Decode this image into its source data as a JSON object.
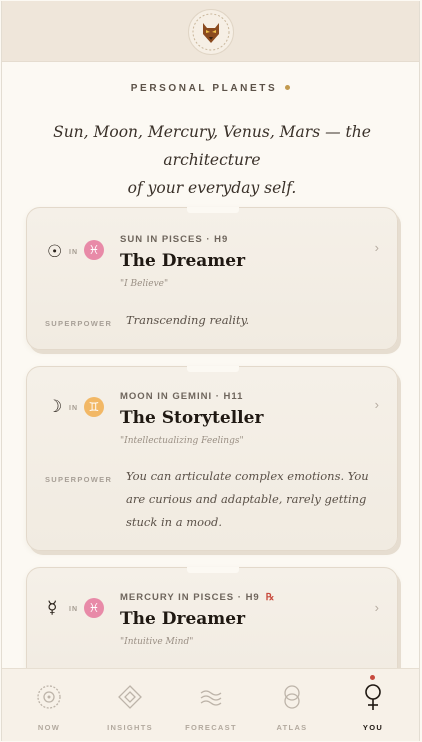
{
  "header": {
    "logo_icon": "wolf-medallion-icon"
  },
  "section": {
    "title": "PERSONAL PLANETS",
    "dot_color": "#c29a4f"
  },
  "intro": {
    "line1": "Sun, Moon, Mercury, Venus, Mars — the architecture",
    "line2": "of your everyday self."
  },
  "cards": [
    {
      "planet_glyph": "☉",
      "planet_icon": "sun-icon",
      "in_label": "IN",
      "sign_glyph": "♓",
      "sign_icon": "pisces-icon",
      "sign_color": "#e88aa8",
      "placement": "SUN IN PISCES · H9",
      "archetype": "The Dreamer",
      "motto": "\"I Believe\"",
      "superpower_label": "SUPERPOWER",
      "superpower": "Transcending reality."
    },
    {
      "planet_glyph": "☽",
      "planet_icon": "moon-icon",
      "in_label": "IN",
      "sign_glyph": "♊",
      "sign_icon": "gemini-icon",
      "sign_color": "#f2b866",
      "placement": "MOON IN GEMINI · H11",
      "archetype": "The Storyteller",
      "motto": "\"Intellectualizing Feelings\"",
      "superpower_label": "SUPERPOWER",
      "superpower": "You can articulate complex emotions. You are curious and adaptable, rarely getting stuck in a mood."
    },
    {
      "planet_glyph": "☿",
      "planet_icon": "mercury-icon",
      "in_label": "IN",
      "sign_glyph": "♓",
      "sign_icon": "pisces-icon",
      "sign_color": "#e88aa8",
      "placement": "MERCURY IN PISCES · H9",
      "retrograde": "℞",
      "archetype": "The Dreamer",
      "motto": "\"Intuitive Mind\""
    }
  ],
  "chevron": "›",
  "nav": [
    {
      "label": "NOW",
      "icon": "now-circle-icon"
    },
    {
      "label": "INSIGHTS",
      "icon": "insights-diamond-icon"
    },
    {
      "label": "FORECAST",
      "icon": "forecast-waves-icon"
    },
    {
      "label": "ATLAS",
      "icon": "atlas-rings-icon"
    },
    {
      "label": "YOU",
      "icon": "you-venus-icon",
      "active": true
    }
  ],
  "colors": {
    "background": "#fcf9f3",
    "header_bg": "#efe6da",
    "accent_red": "#c74a3d"
  }
}
